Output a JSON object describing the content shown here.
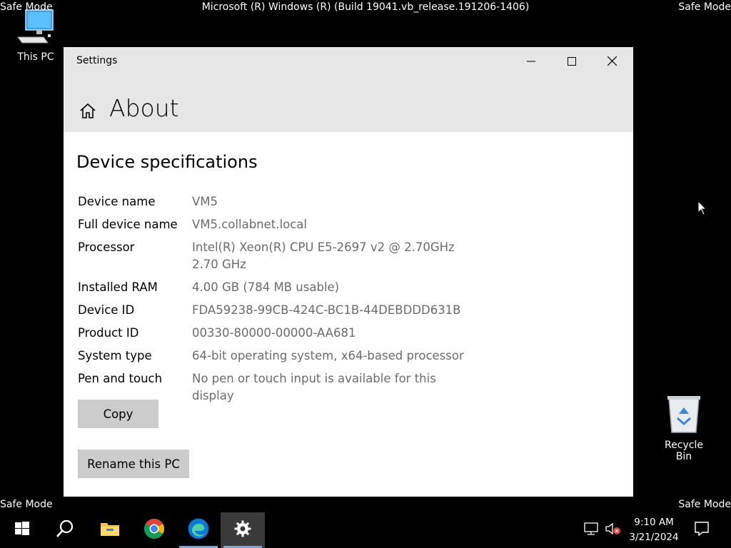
{
  "desktop": {
    "safe_mode_label": "Safe Mode",
    "build_text": "Microsoft (R) Windows (R) (Build 19041.vb_release.191206-1406)",
    "icons": [
      {
        "label": "This PC",
        "icon": "this-pc-icon"
      },
      {
        "label": "Recycle Bin",
        "icon": "recycle-bin-icon"
      }
    ]
  },
  "window": {
    "title": "Settings",
    "buttons": [
      "minimize",
      "maximize",
      "close"
    ],
    "page_title": "About",
    "section_title": "Device specifications",
    "specs": [
      {
        "label": "Device name",
        "value": "VM5"
      },
      {
        "label": "Full device name",
        "value": "VM5.collabnet.local"
      },
      {
        "label": "Processor",
        "value": "Intel(R) Xeon(R) CPU E5-2697 v2 @ 2.70GHz   2.70 GHz"
      },
      {
        "label": "Installed RAM",
        "value": "4.00 GB (784 MB usable)"
      },
      {
        "label": "Device ID",
        "value": "FDA59238-99CB-424C-BC1B-44DEBDDD631B"
      },
      {
        "label": "Product ID",
        "value": "00330-80000-00000-AA681"
      },
      {
        "label": "System type",
        "value": "64-bit operating system, x64-based processor"
      },
      {
        "label": "Pen and touch",
        "value": "No pen or touch input is available for this display"
      }
    ],
    "copy_label": "Copy",
    "rename_label": "Rename this PC"
  },
  "taskbar": {
    "apps": [
      "start",
      "search",
      "file-explorer",
      "chrome",
      "edge",
      "settings"
    ],
    "active_app": "settings",
    "time": "9:10 AM",
    "date": "3/21/2024"
  },
  "colors": {
    "accent": "#7aa7d9",
    "window_header": "#e6e6e6",
    "button": "#cccccc",
    "value_text": "#6b6b6b"
  }
}
